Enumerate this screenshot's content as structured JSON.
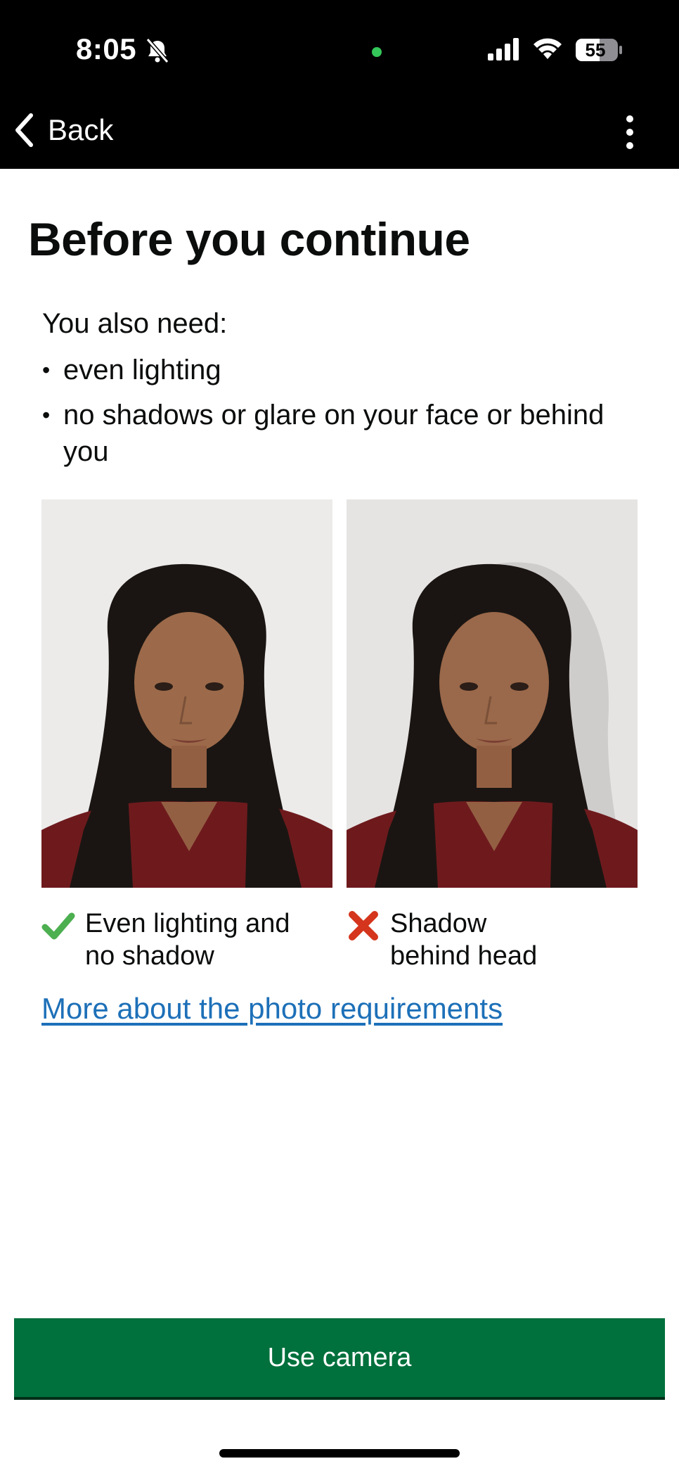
{
  "status_bar": {
    "time": "8:05",
    "battery": "55",
    "icons": [
      "bell-slash-icon",
      "signal-icon",
      "wifi-icon",
      "battery-icon"
    ]
  },
  "nav": {
    "back_label": "Back",
    "back_icon": "chevron-left-icon",
    "menu_icon": "more-vertical-icon"
  },
  "page": {
    "title": "Before you continue",
    "intro": "You also need:",
    "bullets": [
      "even lighting",
      "no shadows or glare on your face or behind you"
    ]
  },
  "examples": [
    {
      "caption": "Even lighting and no shadow",
      "status": "correct",
      "mark_icon": "check-icon",
      "mark_color": "#4caf50"
    },
    {
      "caption": "Shadow behind head",
      "status": "incorrect",
      "mark_icon": "cross-icon",
      "mark_color": "#d4351c"
    }
  ],
  "link": {
    "label": "More about the photo requirements",
    "color": "#1d70b8"
  },
  "button": {
    "label": "Use camera",
    "color": "#00703c"
  }
}
